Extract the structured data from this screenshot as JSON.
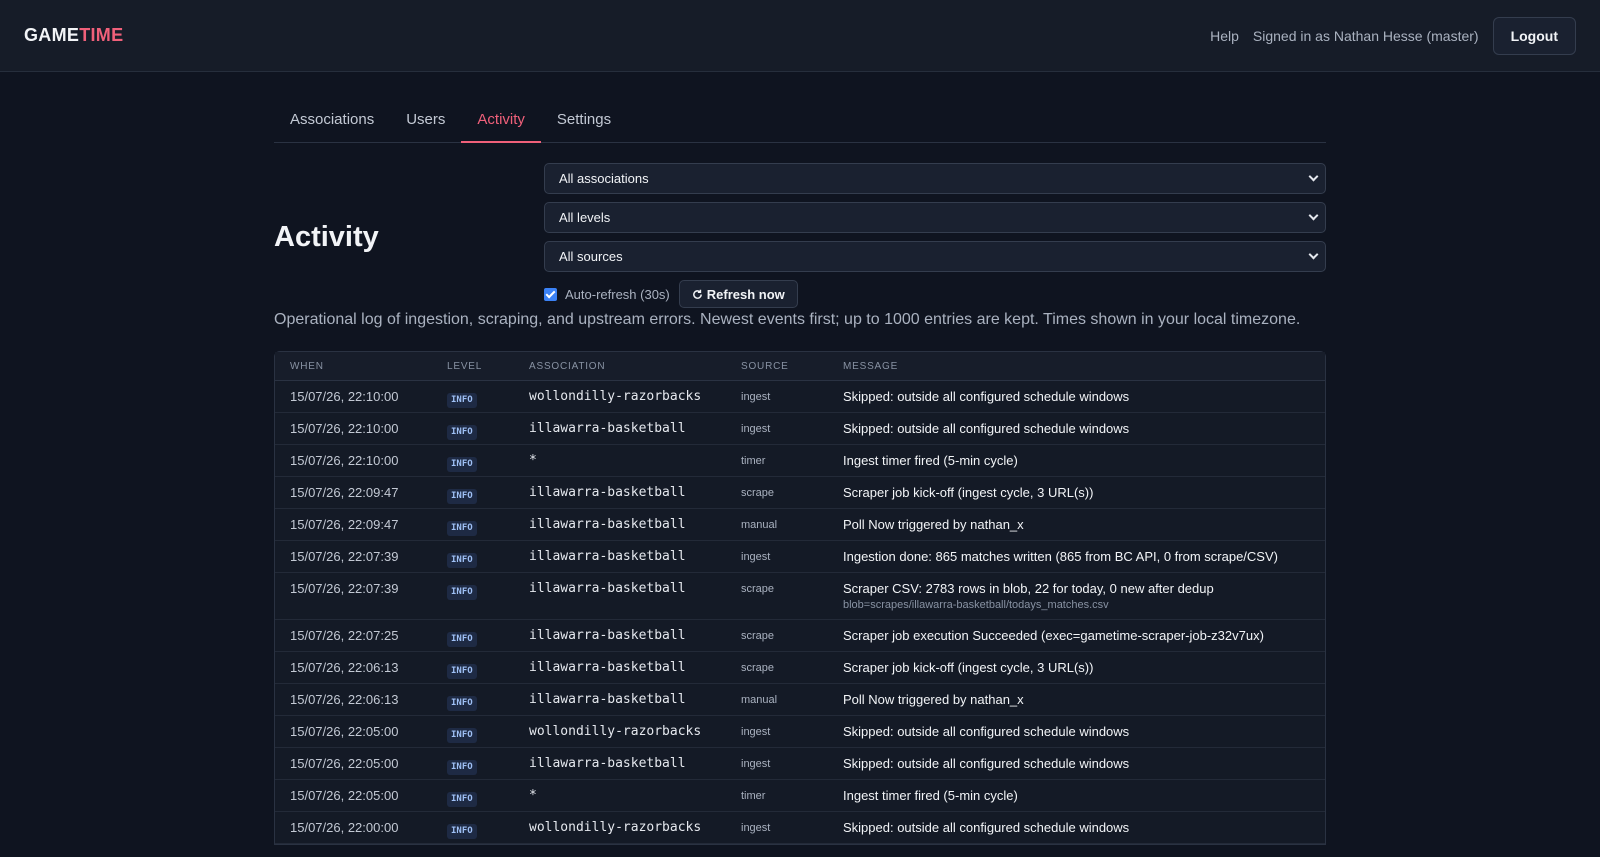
{
  "brand": {
    "part1": "GAME",
    "part2": "TIME"
  },
  "topbar": {
    "help": "Help",
    "signed_in": "Signed in as Nathan Hesse (master)",
    "logout": "Logout"
  },
  "tabs": [
    {
      "label": "Associations"
    },
    {
      "label": "Users"
    },
    {
      "label": "Activity",
      "active": true
    },
    {
      "label": "Settings"
    }
  ],
  "page_title": "Activity",
  "filters": {
    "association": "All associations",
    "level": "All levels",
    "source": "All sources"
  },
  "auto_refresh": {
    "label": "Auto-refresh (30s)",
    "checked": true
  },
  "refresh_button": {
    "label": "Refresh now",
    "icon": "refresh-icon"
  },
  "description": "Operational log of ingestion, scraping, and upstream errors. Newest events first; up to 1000 entries are kept. Times shown in your local timezone.",
  "table": {
    "headers": {
      "when": "WHEN",
      "level": "LEVEL",
      "association": "ASSOCIATION",
      "source": "SOURCE",
      "message": "MESSAGE"
    },
    "rows": [
      {
        "when": "15/07/26, 22:10:00",
        "level": "INFO",
        "association": "wollondilly-razorbacks",
        "source": "ingest",
        "message": "Skipped: outside all configured schedule windows"
      },
      {
        "when": "15/07/26, 22:10:00",
        "level": "INFO",
        "association": "illawarra-basketball",
        "source": "ingest",
        "message": "Skipped: outside all configured schedule windows"
      },
      {
        "when": "15/07/26, 22:10:00",
        "level": "INFO",
        "association": "*",
        "source": "timer",
        "message": "Ingest timer fired (5-min cycle)"
      },
      {
        "when": "15/07/26, 22:09:47",
        "level": "INFO",
        "association": "illawarra-basketball",
        "source": "scrape",
        "message": "Scraper job kick-off (ingest cycle, 3 URL(s))"
      },
      {
        "when": "15/07/26, 22:09:47",
        "level": "INFO",
        "association": "illawarra-basketball",
        "source": "manual",
        "message": "Poll Now triggered by nathan_x"
      },
      {
        "when": "15/07/26, 22:07:39",
        "level": "INFO",
        "association": "illawarra-basketball",
        "source": "ingest",
        "message": "Ingestion done: 865 matches written (865 from BC API, 0 from scrape/CSV)"
      },
      {
        "when": "15/07/26, 22:07:39",
        "level": "INFO",
        "association": "illawarra-basketball",
        "source": "scrape",
        "message": "Scraper CSV: 2783 rows in blob, 22 for today, 0 new after dedup",
        "sub": "blob=scrapes/illawarra-basketball/todays_matches.csv"
      },
      {
        "when": "15/07/26, 22:07:25",
        "level": "INFO",
        "association": "illawarra-basketball",
        "source": "scrape",
        "message": "Scraper job execution Succeeded (exec=gametime-scraper-job-z32v7ux)"
      },
      {
        "when": "15/07/26, 22:06:13",
        "level": "INFO",
        "association": "illawarra-basketball",
        "source": "scrape",
        "message": "Scraper job kick-off (ingest cycle, 3 URL(s))"
      },
      {
        "when": "15/07/26, 22:06:13",
        "level": "INFO",
        "association": "illawarra-basketball",
        "source": "manual",
        "message": "Poll Now triggered by nathan_x"
      },
      {
        "when": "15/07/26, 22:05:00",
        "level": "INFO",
        "association": "wollondilly-razorbacks",
        "source": "ingest",
        "message": "Skipped: outside all configured schedule windows"
      },
      {
        "when": "15/07/26, 22:05:00",
        "level": "INFO",
        "association": "illawarra-basketball",
        "source": "ingest",
        "message": "Skipped: outside all configured schedule windows"
      },
      {
        "when": "15/07/26, 22:05:00",
        "level": "INFO",
        "association": "*",
        "source": "timer",
        "message": "Ingest timer fired (5-min cycle)"
      },
      {
        "when": "15/07/26, 22:00:00",
        "level": "INFO",
        "association": "wollondilly-razorbacks",
        "source": "ingest",
        "message": "Skipped: outside all configured schedule windows"
      }
    ]
  }
}
